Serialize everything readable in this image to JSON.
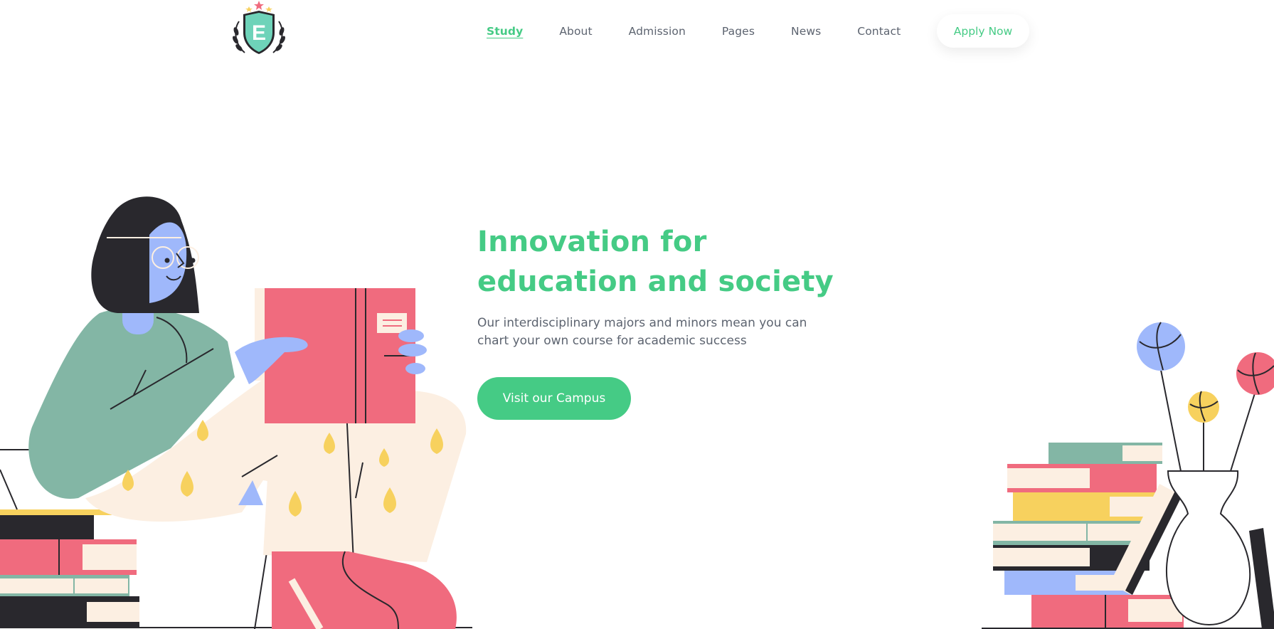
{
  "logo": {
    "letter": "E",
    "icon": "shield-logo-icon"
  },
  "nav": {
    "items": [
      {
        "label": "Study",
        "active": true
      },
      {
        "label": "About",
        "active": false
      },
      {
        "label": "Admission",
        "active": false
      },
      {
        "label": "Pages",
        "active": false
      },
      {
        "label": "News",
        "active": false
      },
      {
        "label": "Contact",
        "active": false
      }
    ],
    "apply_label": "Apply Now"
  },
  "hero": {
    "title_line1": "Innovation for",
    "title_line2": "education and society",
    "text_line1": "Our interdisciplinary majors and minors mean you can",
    "text_line2": "chart your own course for academic success",
    "cta_label": "Visit our Campus"
  },
  "colors": {
    "accent": "#45cb85",
    "text": "#5d6470",
    "pink": "#f06b7e",
    "green": "#83b6a5",
    "yellow": "#f7d15e",
    "blue": "#9fb8fb",
    "cream": "#fcefe2",
    "dark": "#29282d"
  }
}
